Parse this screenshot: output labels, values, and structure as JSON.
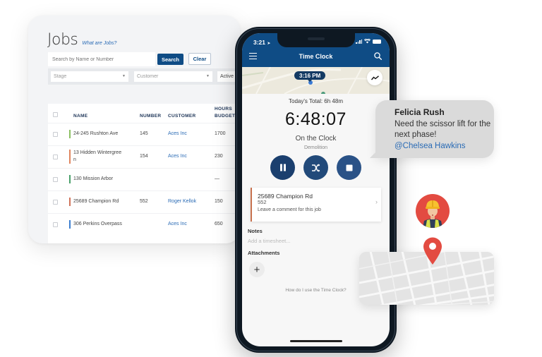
{
  "jobs_panel": {
    "title": "Jobs",
    "help_link": "What are Jobs?",
    "search": {
      "placeholder": "Search by Name or Number",
      "value": ""
    },
    "search_button": "Search",
    "clear_button": "Clear",
    "filters": [
      {
        "placeholder": "Stage"
      },
      {
        "placeholder": "Customer"
      },
      {
        "value": "Active"
      }
    ],
    "table": {
      "columns": [
        "NAME",
        "NUMBER",
        "CUSTOMER",
        "HOURS",
        "BUDGET"
      ],
      "rows": [
        {
          "name": "24-245 Rushton Ave",
          "number": "145",
          "customer": "Aces Inc",
          "hours_budget": "1700",
          "stage_color": "#8cc063"
        },
        {
          "name": "13 Hidden Wintergree",
          "name_cont": "n",
          "number": "154",
          "customer": "Aces Inc",
          "hours_budget": "230",
          "stage_color": "#e0855f"
        },
        {
          "name": "130 Mission Arbor",
          "number": "",
          "customer": "",
          "hours_budget": "—",
          "stage_color": "#4aa06a"
        },
        {
          "name": "25689 Champion Rd",
          "number": "552",
          "customer": "Roger Kellok",
          "hours_budget": "150",
          "stage_color": "#d0735a"
        },
        {
          "name": "306 Perkins Overpass",
          "number": "",
          "customer": "Aces Inc",
          "hours_budget": "650",
          "stage_color": "#3d7fd0"
        }
      ]
    }
  },
  "phone": {
    "status_time": "3:21",
    "header_title": "Time Clock",
    "map_time_badge": "3:16 PM",
    "todays_total": "Today's Total: 6h 48m",
    "elapsed": "6:48:07",
    "status": "On the Clock",
    "job_type": "Demolition",
    "job_card": {
      "name": "25689 Champion Rd",
      "number": "552",
      "comment_prompt": "Leave a comment for this job"
    },
    "notes_label": "Notes",
    "notes_placeholder": "Add a timesheet...",
    "attachments_label": "Attachments",
    "add_attachment": "+",
    "help_link": "How do I use the Time Clock?"
  },
  "chat": {
    "sender": "Felicia Rush",
    "message": "Need the scissor lift for the next phase!",
    "mention": "@Chelsea Hawkins"
  },
  "colors": {
    "brand_blue": "#0f4c85",
    "link_blue": "#2a6bb5",
    "pin_red": "#e34b41"
  }
}
